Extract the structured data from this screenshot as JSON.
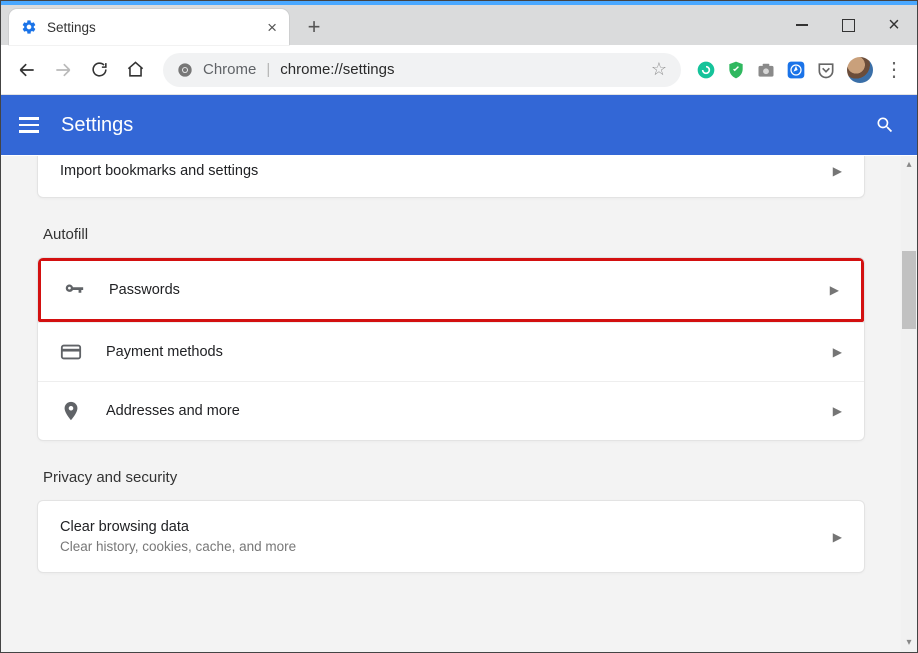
{
  "window": {
    "tab_title": "Settings"
  },
  "omnibox": {
    "prefix": "Chrome",
    "url": "chrome://settings"
  },
  "app": {
    "title": "Settings"
  },
  "sections": {
    "import_row": "Import bookmarks and settings",
    "autofill_title": "Autofill",
    "autofill_items": [
      {
        "label": "Passwords"
      },
      {
        "label": "Payment methods"
      },
      {
        "label": "Addresses and more"
      }
    ],
    "privacy_title": "Privacy and security",
    "privacy_items": [
      {
        "label": "Clear browsing data",
        "sub": "Clear history, cookies, cache, and more"
      }
    ]
  }
}
